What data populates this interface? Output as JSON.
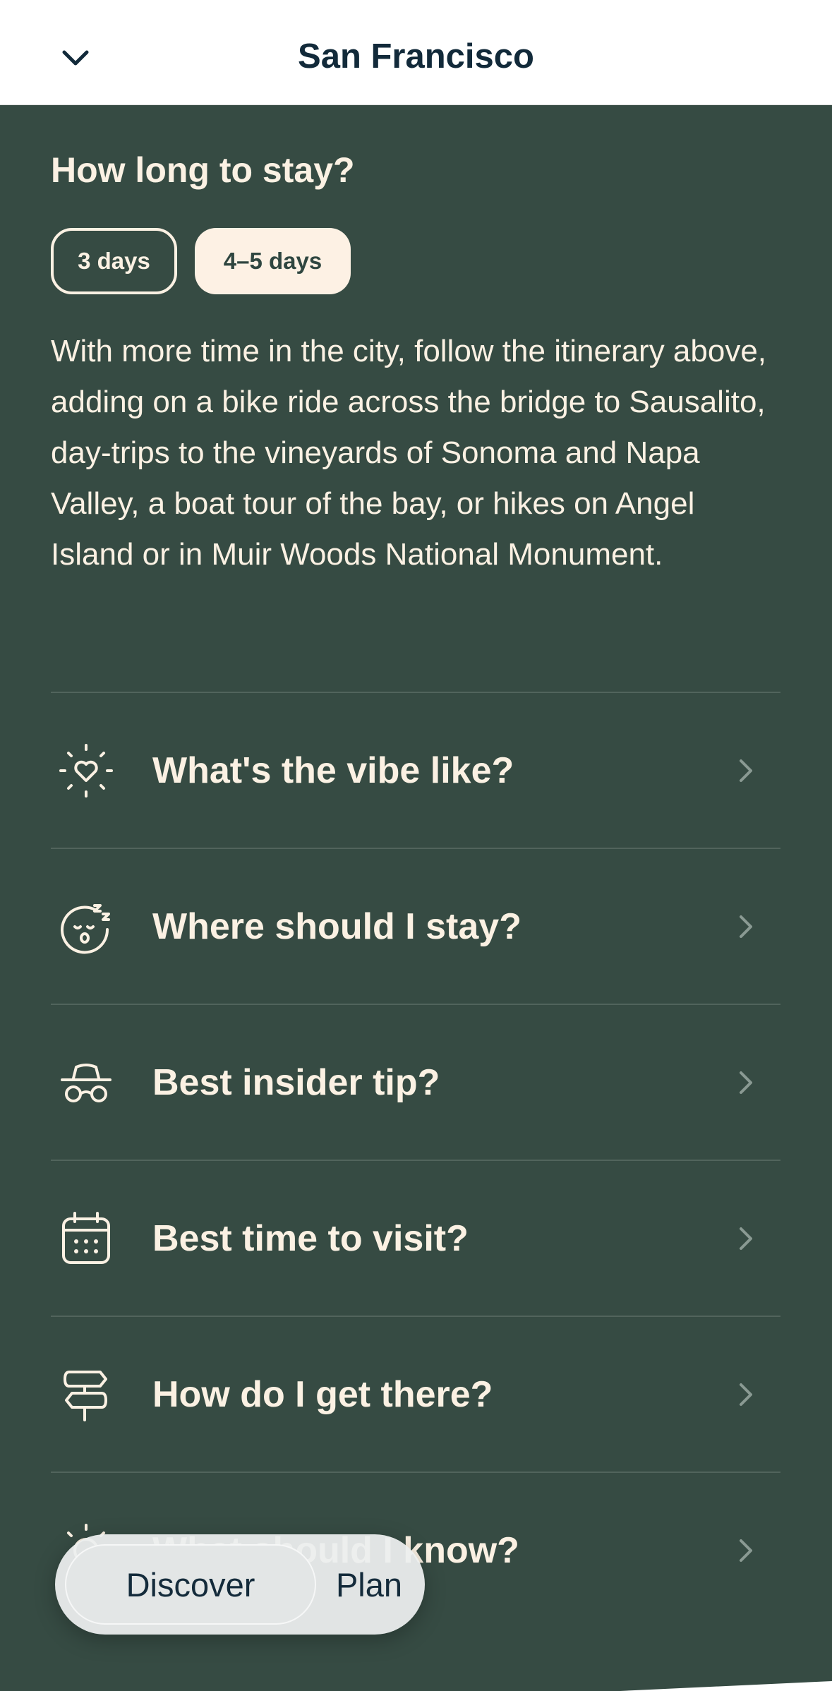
{
  "header": {
    "title": "San Francisco",
    "back_icon": "chevron-down-icon"
  },
  "stay": {
    "heading": "How long to stay?",
    "options": [
      {
        "label": "3 days",
        "selected": false
      },
      {
        "label": "4–5 days",
        "selected": true
      }
    ],
    "description": "With more time in the city, follow the itinerary above, adding on a bike ride across the bridge to Sausalito, day-trips to the vineyards of Sonoma and Napa Valley, a boat tour of the bay, or hikes on Angel Island or in Muir Woods National Monument."
  },
  "faq": [
    {
      "label": "What's the vibe like?",
      "icon": "sparkle-heart-icon"
    },
    {
      "label": "Where should I stay?",
      "icon": "sleeping-face-icon"
    },
    {
      "label": "Best insider tip?",
      "icon": "incognito-icon"
    },
    {
      "label": "Best time to visit?",
      "icon": "calendar-icon"
    },
    {
      "label": "How do I get there?",
      "icon": "signpost-icon"
    },
    {
      "label": "What should I know?",
      "icon": "sun-icon"
    }
  ],
  "bottom_nav": {
    "discover": "Discover",
    "plan": "Plan",
    "active": "Discover"
  },
  "colors": {
    "background": "#364b43",
    "text_cream": "#fbf1e3",
    "title_navy": "#122a3a",
    "selected_pill": "#fdf1e4"
  }
}
